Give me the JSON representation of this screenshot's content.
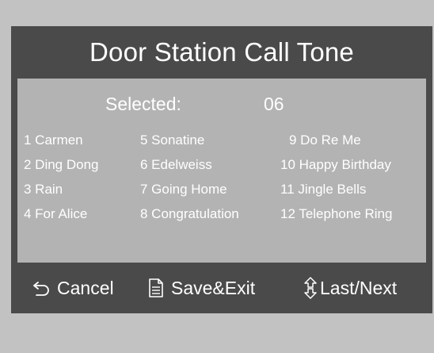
{
  "title": "Door Station Call Tone",
  "selected": {
    "label": "Selected:",
    "value": "06"
  },
  "tones": [
    {
      "label": "1 Carmen"
    },
    {
      "label": "2 Ding Dong"
    },
    {
      "label": "3 Rain"
    },
    {
      "label": "4 For Alice"
    },
    {
      "label": "5 Sonatine"
    },
    {
      "label": "6 Edelweiss"
    },
    {
      "label": "7 Going Home"
    },
    {
      "label": "8 Congratulation"
    },
    {
      "label": "9 Do Re Me"
    },
    {
      "label": "10 Happy Birthday"
    },
    {
      "label": "11 Jingle Bells"
    },
    {
      "label": "12 Telephone Ring"
    }
  ],
  "footer": {
    "cancel_label": "Cancel",
    "cancel_icon": "return-arrow-icon",
    "save_label": "Save&Exit",
    "save_icon": "document-icon",
    "nav_label": "Last/Next",
    "nav_icon": "up-down-arrow-icon"
  },
  "colors": {
    "frame": "#4a4a4a",
    "content": "#b3b3b3",
    "background": "#c2c2c2",
    "text": "#ffffff"
  }
}
